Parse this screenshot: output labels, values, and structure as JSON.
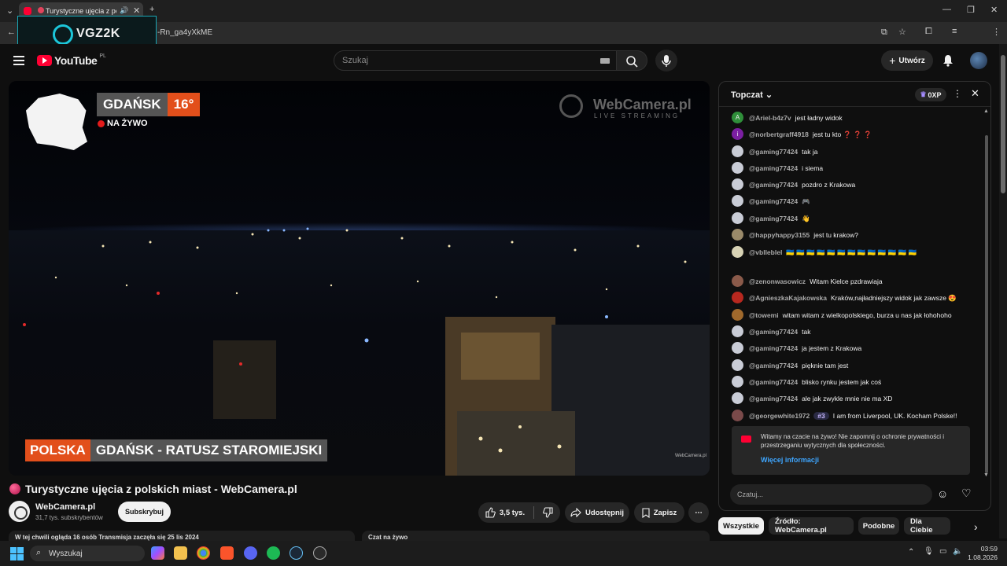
{
  "browser": {
    "tab_title": "Turystyczne ujęcia z pol",
    "url_fragment": "-Rn_ga4yXkME",
    "overlay_logo_text": "VGZ2K",
    "new_tab": "+",
    "window_controls": [
      "—",
      "❐",
      "✕"
    ]
  },
  "header": {
    "logo": "YouTube",
    "country": "PL",
    "search_placeholder": "Szukaj",
    "create_label": "Utwórz"
  },
  "video": {
    "city": "GDAŃSK",
    "temperature": "16°",
    "live_label": "NA ŻYWO",
    "brand": "WebCamera.pl",
    "brand_sub": "LIVE STREAMING",
    "lower_third_country": "POLSKA",
    "lower_third_place": "GDAŃSK - RATUSZ STAROMIEJSKI",
    "watermark": "WebCamera.pl"
  },
  "below": {
    "title": "Turystyczne ujęcia z polskich miast - WebCamera.pl",
    "channel": "WebCamera.pl",
    "subscribers": "31,7 tys. subskrybentów",
    "subscribe": "Subskrybuj",
    "likes": "3,5 tys.",
    "share": "Udostępnij",
    "save": "Zapisz",
    "more": "⋯",
    "info_left": "W tej chwili ogląda 16 osób  Transmisja zaczęła się 25 lis 2024",
    "info_right": "Czat na żywo"
  },
  "chat": {
    "title": "Topczat",
    "xp": "0XP",
    "messages": [
      {
        "author": "@Ariel-b4z7v",
        "text": "jest ładny widok",
        "avatar": "A",
        "color": "#2f8f3a"
      },
      {
        "author": "@norbertgraff4918",
        "text": "jest tu kto ❓ ❓ ❓",
        "avatar": "i",
        "color": "#7b1fa2"
      },
      {
        "author": "@gaming77424",
        "text": "tak ja",
        "avatar": "",
        "color": "#c9ccd6"
      },
      {
        "author": "@gaming77424",
        "text": "i siema",
        "avatar": "",
        "color": "#c9ccd6"
      },
      {
        "author": "@gaming77424",
        "text": "pozdro z Krakowa",
        "avatar": "",
        "color": "#c9ccd6"
      },
      {
        "author": "@gaming77424",
        "text": "🎮",
        "avatar": "",
        "color": "#c9ccd6"
      },
      {
        "author": "@gaming77424",
        "text": "👋",
        "avatar": "",
        "color": "#c9ccd6"
      },
      {
        "author": "@happyhappy3155",
        "text": "jest tu krakow?",
        "avatar": "",
        "color": "#9a8a6a"
      },
      {
        "author": "@vblleblel",
        "text": "🇺🇦 🇺🇦 🇺🇦 🇺🇦 🇺🇦 🇺🇦 🇺🇦 🇺🇦 🇺🇦 🇺🇦 🇺🇦 🇺🇦 🇺🇦",
        "avatar": "",
        "color": "#d8d3b5"
      },
      {
        "author": "@zenonwasowicz",
        "text": "Witam Kielce pzdrawiaja",
        "avatar": "",
        "color": "#8a5a4a"
      },
      {
        "author": "@AgnieszkaKajakowska",
        "text": "Kraków,najładniejszy widok jak zawsze 😍",
        "avatar": "",
        "color": "#b7281f"
      },
      {
        "author": "@towemi",
        "text": "witam witam z wielkopolskiego, burza u nas jak łohohoho",
        "avatar": "",
        "color": "#a0692c"
      },
      {
        "author": "@gaming77424",
        "text": "tak",
        "avatar": "",
        "color": "#c9ccd6"
      },
      {
        "author": "@gaming77424",
        "text": "ja jestem z Krakowa",
        "avatar": "",
        "color": "#c9ccd6"
      },
      {
        "author": "@gaming77424",
        "text": "pięknie tam jest",
        "avatar": "",
        "color": "#c9ccd6"
      },
      {
        "author": "@gaming77424",
        "text": "blisko rynku jestem jak coś",
        "avatar": "",
        "color": "#c9ccd6"
      },
      {
        "author": "@gaming77424",
        "text": "ale jak zwykle mnie nie ma XD",
        "avatar": "",
        "color": "#c9ccd6"
      },
      {
        "author": "@georgewhite1972",
        "badge": "#3",
        "text": "I am from Liverpool, UK. Kocham Polske!!",
        "avatar": "",
        "color": "#7a4a4a"
      }
    ],
    "notice_text": "Witamy na czacie na żywo! Nie zapomnij o ochronie prywatności i przestrzeganiu wytycznych dla społeczności.",
    "notice_link": "Więcej informacji",
    "input_placeholder": "Czatuj..."
  },
  "chips": [
    "Wszystkie",
    "Źródło: WebCamera.pl",
    "Podobne",
    "Dla Ciebie"
  ],
  "taskbar": {
    "search": "Wyszukaj",
    "time": "03:59",
    "date": "1.08.2026"
  }
}
